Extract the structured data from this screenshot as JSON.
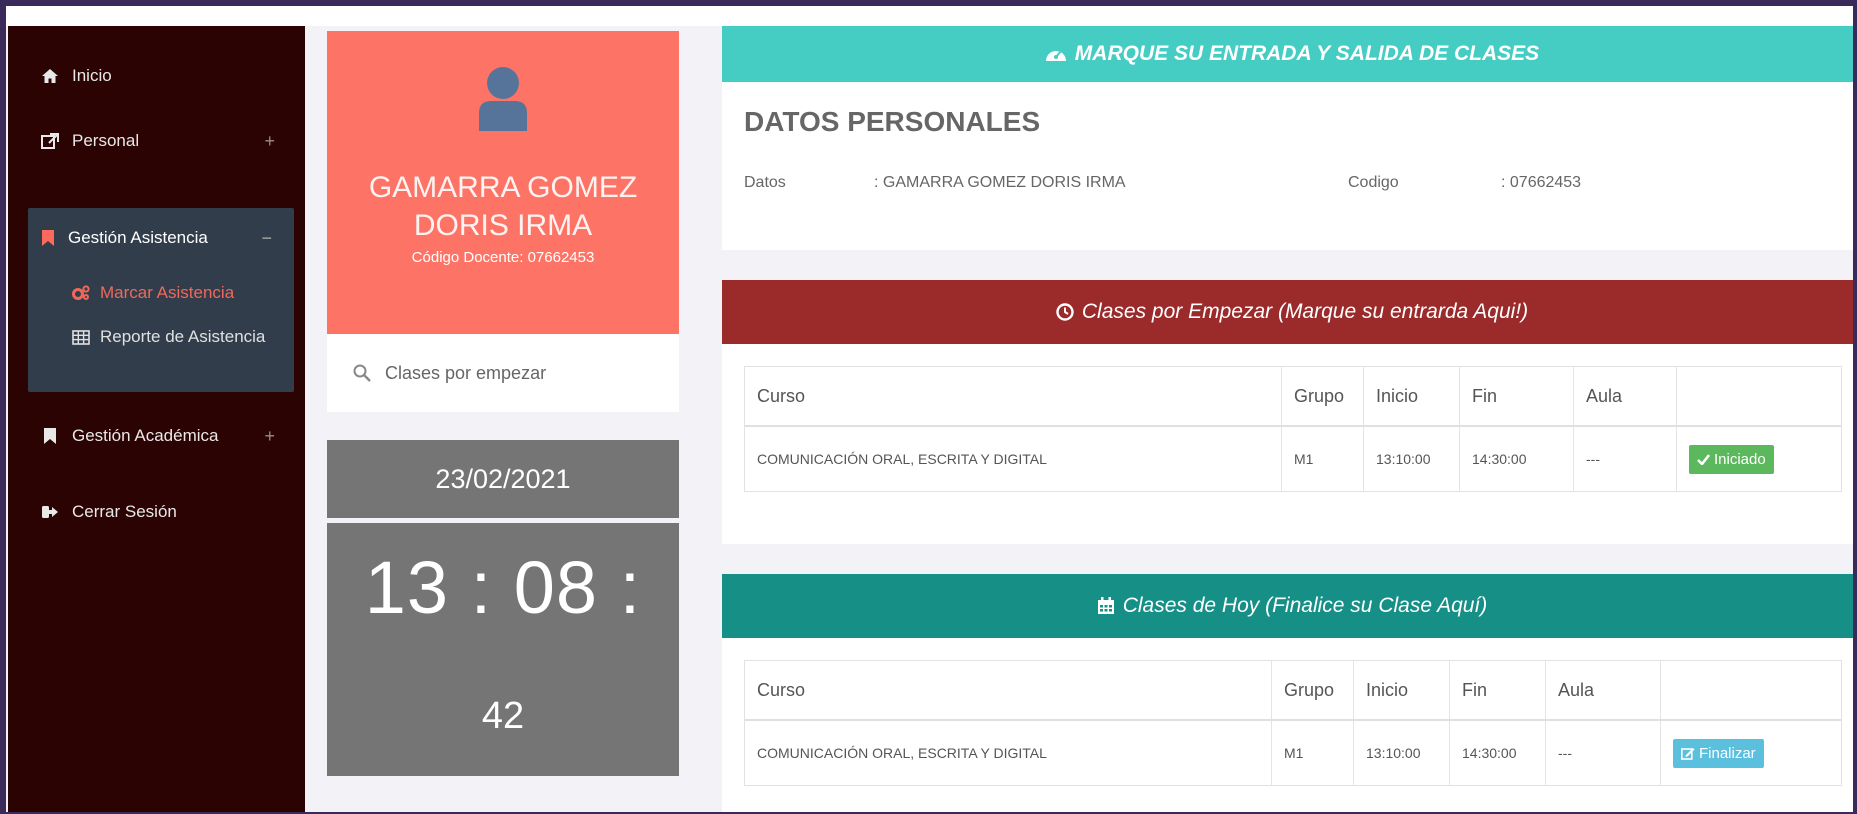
{
  "sidebar": {
    "items": [
      {
        "label": "Inicio",
        "icon": "home-icon"
      },
      {
        "label": "Personal",
        "icon": "external-link-icon",
        "toggle": "+"
      },
      {
        "label": "Gestión Asistencia",
        "icon": "bookmark-icon",
        "toggle": "−"
      },
      {
        "label": "Gestión Académica",
        "icon": "bookmark-icon",
        "toggle": "+"
      },
      {
        "label": "Cerrar Sesión",
        "icon": "sign-out-icon"
      }
    ],
    "submenu": [
      {
        "label": "Marcar Asistencia",
        "icon": "cogs-icon",
        "active": true,
        "color": "#f0685a"
      },
      {
        "label": "Reporte de Asistencia",
        "icon": "table-icon",
        "active": false
      }
    ]
  },
  "profile": {
    "name_line1": "GAMARRA GOMEZ",
    "name_line2": "DORIS IRMA",
    "code": "Código Docente: 07662453",
    "search_label": "Clases por empezar"
  },
  "clock": {
    "date": "23/02/2021",
    "hours_minutes": "13 : 08 :",
    "seconds": "42"
  },
  "main": {
    "header": "MARQUE SU ENTRADA Y SALIDA DE CLASES",
    "personal_title": "DATOS PERSONALES",
    "datos_label": "Datos",
    "datos_value": ": GAMARRA GOMEZ DORIS IRMA",
    "codigo_label": "Codigo",
    "codigo_value": ": 07662453"
  },
  "panels": {
    "start": {
      "title": "Clases por Empezar (Marque su entrarda Aqui!)",
      "color": "#9b2a2a",
      "columns": [
        "Curso",
        "Grupo",
        "Inicio",
        "Fin",
        "Aula",
        ""
      ],
      "rows": [
        {
          "curso": "COMUNICACIÓN ORAL, ESCRITA Y DIGITAL",
          "grupo": "M1",
          "inicio": "13:10:00",
          "fin": "14:30:00",
          "aula": "---",
          "action": "Iniciado"
        }
      ]
    },
    "today": {
      "title": "Clases de Hoy (Finalice su Clase Aquí)",
      "color": "#168f86",
      "columns": [
        "Curso",
        "Grupo",
        "Inicio",
        "Fin",
        "Aula",
        ""
      ],
      "rows": [
        {
          "curso": "COMUNICACIÓN ORAL, ESCRITA Y DIGITAL",
          "grupo": "M1",
          "inicio": "13:10:00",
          "fin": "14:30:00",
          "aula": "---",
          "action": "Finalizar"
        }
      ]
    }
  },
  "colors": {
    "sidebar_bg": "#2c0303",
    "submenu_bg": "#323d4c",
    "profile_bg": "#fd7467",
    "clock_bg": "#757575",
    "header_bg": "#45ccc3"
  }
}
